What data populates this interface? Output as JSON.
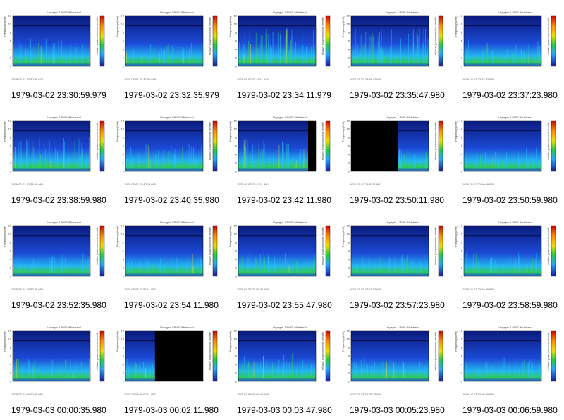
{
  "mission": "Voyager-1 PWS Wideband",
  "y_axis_label": "Frequency (kHz)",
  "colorbar_label": "relative power spectral density",
  "y_ticks": [
    "12",
    "10",
    "8",
    "6",
    "4",
    "2",
    "0"
  ],
  "panels": [
    {
      "caption": "1979-03-02 23:30:59.979",
      "file": "1979-03-02 23:30:59.979",
      "level": 1.0,
      "mask": null
    },
    {
      "caption": "1979-03-02 23:32:35.979",
      "file": "1979-03-02 23:32:35.979",
      "level": 0.8,
      "mask": null
    },
    {
      "caption": "1979-03-02 23:34:11.979",
      "file": "1979-03-02 23:34:11.979",
      "level": 1.6,
      "mask": null
    },
    {
      "caption": "1979-03-02 23:35:47.980",
      "file": "1979-03-02 23:35:47.980",
      "level": 1.5,
      "mask": null
    },
    {
      "caption": "1979-03-02 23:37:23.980",
      "file": "1979-03-02 23:37:23.980",
      "level": 0.9,
      "mask": null
    },
    {
      "caption": "1979-03-02 23:38:59.980",
      "file": "1979-03-02 23:38:59.980",
      "level": 1.3,
      "mask": null
    },
    {
      "caption": "1979-03-02 23:40:35.980",
      "file": "1979-03-02 23:40:35.980",
      "level": 1.0,
      "mask": null
    },
    {
      "caption": "1979-03-02 23:42:11.980",
      "file": "1979-03-02 23:42:11.980",
      "level": 1.2,
      "mask": "right-small"
    },
    {
      "caption": "1979-03-02 23:50:11.980",
      "file": "1979-03-02 23:50:11.980",
      "level": 0.8,
      "mask": "left-large"
    },
    {
      "caption": "1979-03-02 23:50:59.980",
      "file": "1979-03-02 23:50:59.980",
      "level": 0.8,
      "mask": null
    },
    {
      "caption": "1979-03-02 23:52:35.980",
      "file": "1979-03-02 23:52:35.980",
      "level": 0.7,
      "mask": null
    },
    {
      "caption": "1979-03-02 23:54:11.980",
      "file": "1979-03-02 23:54:11.980",
      "level": 0.7,
      "mask": null
    },
    {
      "caption": "1979-03-02 23:55:47.980",
      "file": "1979-03-02 23:55:47.980",
      "level": 0.8,
      "mask": null
    },
    {
      "caption": "1979-03-02 23:57:23.980",
      "file": "1979-03-02 23:57:23.980",
      "level": 0.7,
      "mask": null
    },
    {
      "caption": "1979-03-02 23:58:59.980",
      "file": "1979-03-02 23:58:59.980",
      "level": 0.8,
      "mask": null
    },
    {
      "caption": "1979-03-03 00:00:35.980",
      "file": "1979-03-03 00:00:35.980",
      "level": 0.8,
      "mask": null
    },
    {
      "caption": "1979-03-03 00:02:11.980",
      "file": "1979-03-03 00:02:11.980",
      "level": 0.8,
      "mask": "right-large"
    },
    {
      "caption": "1979-03-03 00:03:47.980",
      "file": "1979-03-03 00:03:47.980",
      "level": 1.0,
      "mask": null
    },
    {
      "caption": "1979-03-03 00:05:23.980",
      "file": "1979-03-03 00:05:23.980",
      "level": 0.8,
      "mask": null
    },
    {
      "caption": "1979-03-03 00:06:59.980",
      "file": "1979-03-03 00:06:59.980",
      "level": 0.8,
      "mask": null
    }
  ],
  "colors": {
    "bg_dark": "#0a1a7a",
    "bg_mid": "#1d4fe0",
    "band_cyan": "#28c8ff",
    "band_green": "#33dd55",
    "band_yellow": "#e8e020",
    "mask": "#000000"
  }
}
